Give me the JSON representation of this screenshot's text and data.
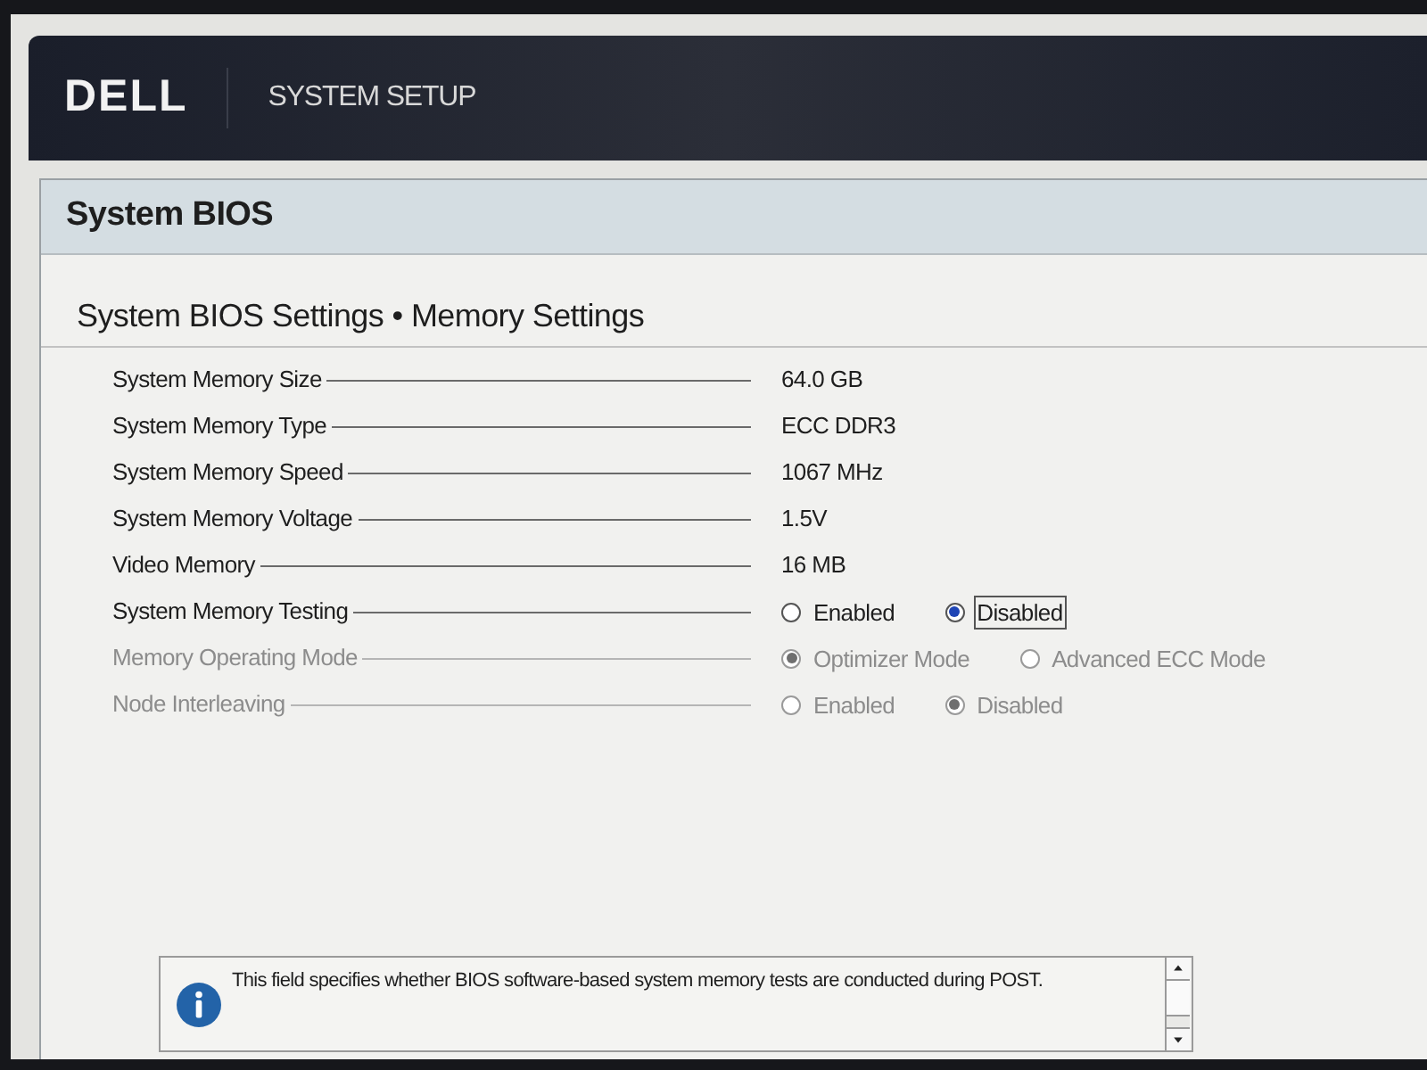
{
  "header": {
    "logo": "DELL",
    "title": "SYSTEM SETUP"
  },
  "panel": {
    "title": "System BIOS",
    "subtitle": "System BIOS Settings • Memory Settings",
    "settings": [
      {
        "kind": "value",
        "label": "System Memory Size",
        "value": "64.0 GB",
        "disabled": false
      },
      {
        "kind": "value",
        "label": "System Memory Type",
        "value": "ECC DDR3",
        "disabled": false
      },
      {
        "kind": "value",
        "label": "System Memory Speed",
        "value": "1067 MHz",
        "disabled": false
      },
      {
        "kind": "value",
        "label": "System Memory Voltage",
        "value": "1.5V",
        "disabled": false
      },
      {
        "kind": "value",
        "label": "Video Memory",
        "value": "16 MB",
        "disabled": false
      },
      {
        "kind": "radio",
        "label": "System Memory Testing",
        "disabled": false,
        "options": [
          {
            "label": "Enabled",
            "selected": false,
            "focused": false
          },
          {
            "label": "Disabled",
            "selected": true,
            "focused": true
          }
        ]
      },
      {
        "kind": "radio",
        "label": "Memory Operating Mode",
        "disabled": true,
        "options": [
          {
            "label": "Optimizer Mode",
            "selected": true,
            "focused": false
          },
          {
            "label": "Advanced ECC Mode",
            "selected": false,
            "focused": false
          }
        ]
      },
      {
        "kind": "radio",
        "label": "Node Interleaving",
        "disabled": true,
        "options": [
          {
            "label": "Enabled",
            "selected": false,
            "focused": false
          },
          {
            "label": "Disabled",
            "selected": true,
            "focused": false
          }
        ]
      }
    ]
  },
  "help": {
    "text": "This field specifies whether BIOS software-based system memory tests are conducted during POST."
  }
}
